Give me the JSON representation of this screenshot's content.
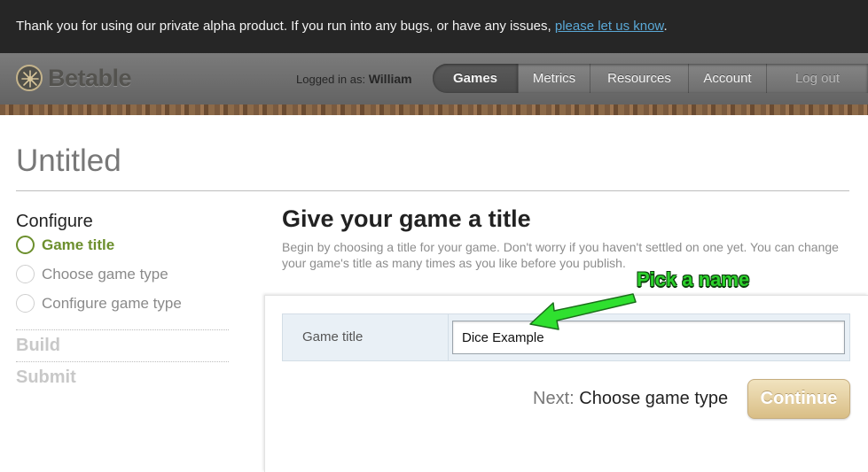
{
  "banner": {
    "message": "Thank you for using our private alpha product. If you run into any bugs, or have any issues,",
    "link_text": "please let us know",
    "end": "."
  },
  "brand": {
    "name": "Betable"
  },
  "user": {
    "logged_in_label": "Logged in as:",
    "name": "William"
  },
  "nav": {
    "items": [
      {
        "label": "Games",
        "active": true
      },
      {
        "label": "Metrics"
      },
      {
        "label": "Resources"
      },
      {
        "label": "Account"
      },
      {
        "label": "Log out"
      }
    ]
  },
  "page": {
    "title": "Untitled"
  },
  "sidebar": {
    "configure_heading": "Configure",
    "steps": [
      {
        "label": "Game title",
        "state": "current"
      },
      {
        "label": "Choose game type",
        "state": "todo"
      },
      {
        "label": "Configure game type",
        "state": "todo"
      }
    ],
    "build_label": "Build",
    "submit_label": "Submit"
  },
  "main": {
    "heading": "Give your game a title",
    "intro": "Begin by choosing a title for your game. Don't worry if you haven't settled on one yet. You can change your game's title as many times as you like before you publish."
  },
  "form": {
    "field_label": "Game title",
    "field_value": "Dice Example",
    "next_label": "Next:",
    "next_step": "Choose game type",
    "continue_label": "Continue"
  },
  "annotation": {
    "text": "Pick a name"
  },
  "colors": {
    "banner_bg": "#262626",
    "link": "#5aa8d6",
    "current_step": "#6c8f2d",
    "continue_button": "#d9be86",
    "annotation": "#2cd12c"
  },
  "icons": {
    "logo": "crossed-arrows-icon",
    "step_current": "circle-outline-green-icon",
    "step_todo": "circle-outline-gray-icon",
    "annotation_arrow": "arrow-icon"
  }
}
